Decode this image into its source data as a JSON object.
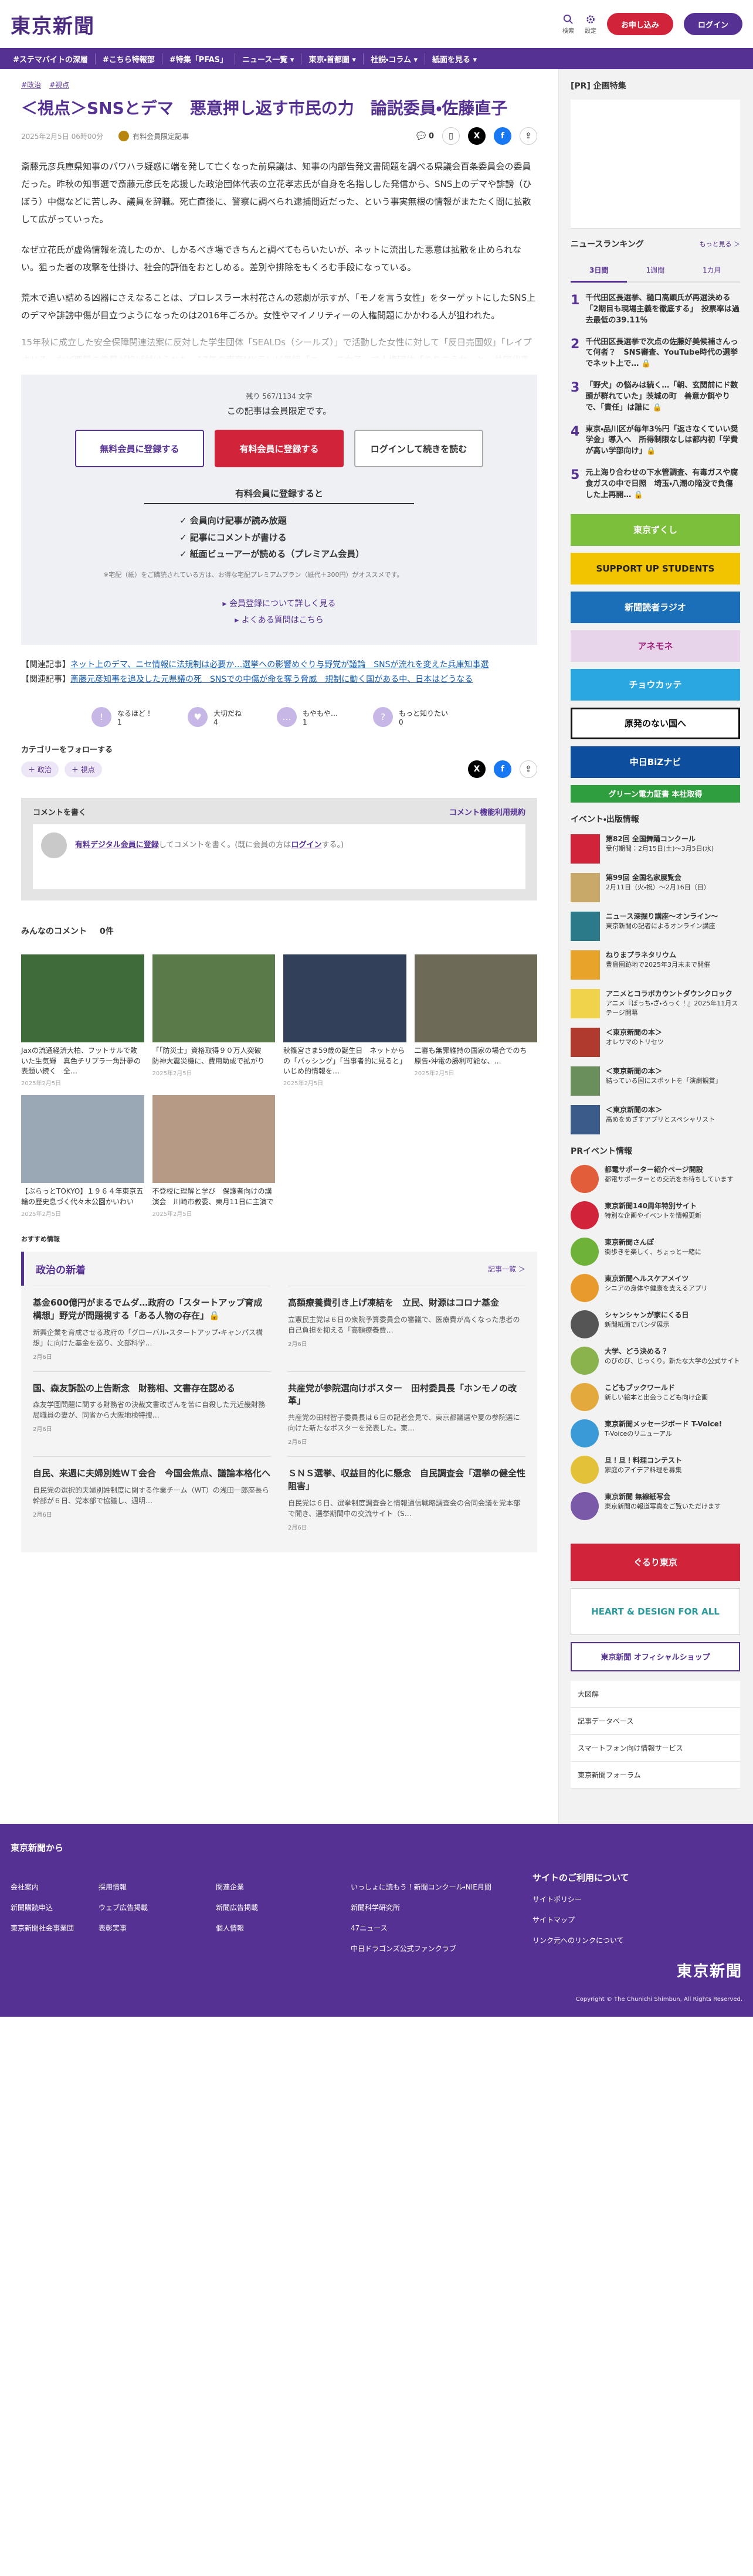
{
  "header": {
    "logo": "東京新聞",
    "search_label": "検索",
    "settings_label": "設定",
    "subscribe_label": "お申し込み",
    "login_label": "ログイン"
  },
  "nav": [
    "#ステマバイトの深層",
    "#こちら特報部",
    "#特集「PFAS」",
    "ニュース一覧 ▾",
    "東京・首都圏 ▾",
    "社説・コラム ▾",
    "紙面を見る ▾"
  ],
  "article": {
    "tags": [
      "#政治",
      "#視点"
    ],
    "title": "＜視点＞SNSとデマ　悪意押し返す市民の力　論説委員・佐藤直子",
    "date": "2025年2月5日 06時00分",
    "badge": "有料会員限定記事",
    "comment_count": "0",
    "paragraphs": [
      "斎藤元彦兵庫県知事のパワハラ疑惑に端を発して亡くなった前県議は、知事の内部告発文書問題を調べる県議会百条委員会の委員だった。昨秋の知事選で斎藤元彦氏を応援した政治団体代表の立花孝志氏が自身を名指しした発信から、SNS上のデマや誹謗（ひぼう）中傷などに苦しみ、議員を辞職。死亡直後に、警察に調べられ逮捕間近だった、という事実無根の情報がまたたく間に拡散して広がっていった。",
      "なぜ立花氏が虚偽情報を流したのか、しかるべき場できちんと調べてもらいたいが、ネットに流出した悪意は拡散を止められない。狙った者の攻撃を仕掛け、社会的評価をおとしめる。差別や排除をもくろむ手段になっている。",
      "荒木で追い詰める凶器にさえなることは、プロレスラー木村花さんの悲劇が示すが、「モノを言う女性」をターゲットにしたSNS上のデマや誹謗中傷が目立つようになったのは2016年ごろか。女性やマイノリティーの人権問題にかかわる人が狙われた。",
      "15年秋に成立した安全保障関連法案に反対した学生団体「SEALDs（シールズ）」で活動した女性に対して「反日売国奴」「レイプさせろ」など悪質の言葉が投げ付けられた。17年の東京MXテレビ番組「ニュース女子」で人権団体「のりこえねっと」共同代表の辛淑玉さんは、沖縄の反基地運動を操る「黒幕」と名指しされ、22年には、性暴力やDV…"
    ]
  },
  "paywall": {
    "count": "残り 567/1134 文字",
    "title": "この記事は会員限定です。",
    "btn_free": "無料会員に登録する",
    "btn_paid": "有料会員に登録する",
    "btn_login": "ログインして続きを読む",
    "benefits_title": "有料会員に登録すると",
    "benefits": [
      "✓ 会員向け記事が読み放題",
      "✓ 記事にコメントが書ける",
      "✓ 紙面ビューアーが読める（プレミアム会員）"
    ],
    "note": "※宅配（紙）をご購読されている方は、お得な宅配プレミアムプラン（紙代＋300円）がオススメです。",
    "link1": "▸ 会員登録について詳しく見る",
    "link2": "▸ よくある質問はこちら"
  },
  "related": [
    {
      "label": "【関連記事】",
      "text": "ネット上のデマ、ニセ情報に法規制は必要か…選挙への影響めぐり与野党が議論　SNSが流れを変えた兵庫知事選"
    },
    {
      "label": "【関連記事】",
      "text": "斎藤元彦知事を追及した元県議の死　SNSでの中傷が命を奪う脅威　規制に動く国がある中、日本はどうなる"
    }
  ],
  "reactions": [
    {
      "label": "なるほど！",
      "count": "1"
    },
    {
      "label": "大切だね",
      "count": "4"
    },
    {
      "label": "もやもや…",
      "count": "1"
    },
    {
      "label": "もっと知りたい",
      "count": "0"
    }
  ],
  "follow": {
    "title": "カテゴリーをフォローする",
    "chips": [
      "＋ 政治",
      "＋ 視点"
    ]
  },
  "comment": {
    "title": "コメントを書く",
    "rules_link": "コメント機能利用規約",
    "login_prefix": "有料デジタル会員に登録",
    "login_mid": "してコメントを書く。(既に会員の方は",
    "login_link": "ログイン",
    "login_suffix": "する。)"
  },
  "all_comments": {
    "title": "みんなのコメント",
    "count": "0件"
  },
  "cards": [
    {
      "cap": "Jaxの流通経済大柏、フットサルで敗いた生気輝　真色チリプラ一角計夢の表題い続く　全…",
      "dt": "2025年2月5日"
    },
    {
      "cap": "「「防災士」資格取得９０万人突破　防神大震災機に、費用助成で拡がり",
      "dt": "2025年2月5日"
    },
    {
      "cap": "秋篠宮さま59歳の誕生日　ネットからの「バッシング」「当事者的に見ると」いじめ的情報を…",
      "dt": "2025年2月5日"
    },
    {
      "cap": "二審も無罪維持の国家の場合でのち　原告・沖電の勝利可能な、…",
      "dt": "2025年2月5日"
    },
    {
      "cap": "【ぶらっとTOKYO】１９６４年東京五輪の歴史息づく代々木公園かいわい",
      "dt": "2025年2月5日"
    },
    {
      "cap": "不登校に理解と学び　保護者向けの講演会　川崎市教委、東月11日に主演で",
      "dt": "2025年2月5日"
    }
  ],
  "osusume": "おすすめ情報",
  "news": {
    "title": "政治の新着",
    "more": "記事一覧 ＞",
    "items": [
      {
        "t": "基金600億円がまるでムダ…政府の「スタートアップ育成構想」野党が問題視する「ある人物の存在」🔒",
        "d": "新興企業を育成させる政府の「グローバル・スタートアップ・キャンパス構想」に向けた基金を巡り、文部科学…",
        "dt": "2月6日"
      },
      {
        "t": "高額療養費引き上げ凍結を　立民、財源はコロナ基金",
        "d": "立憲民主党は６日の衆院予算委員会の審議で、医療費が高くなった患者の自己負担を抑える「高額療養費…",
        "dt": "2月6日"
      },
      {
        "t": "国、森友訴訟の上告断念　財務相、文書存在認める",
        "d": "森友学園問題に関する財務省の決裁文書改ざんを苦に自殺した元近畿財務局職員の妻が、同省から大阪地検特捜…",
        "dt": "2月6日"
      },
      {
        "t": "共産党が参院選向けポスター　田村委員長「ホンモノの改革」",
        "d": "共産党の田村智子委員長は６日の記者会見で、東京都議選や夏の参院選に向けた新たなポスターを発表した。東…",
        "dt": "2月6日"
      },
      {
        "t": "自民、来週に夫婦別姓ＷＴ会合　今国会焦点、議論本格化へ",
        "d": "自民党の選択的夫婦別姓制度に関する作業チーム（WT）の浅田一郎座長ら幹部が６日、党本部で協議し、週明…",
        "dt": "2月6日"
      },
      {
        "t": "ＳＮＳ選挙、収益目的化に懸念　自民調査会「選挙の健全性阻害」",
        "d": "自民党は６日、選挙制度調査会と情報通信戦略調査会の合同会議を党本部で開き、選挙期間中の交流サイト（S…",
        "dt": "2月6日"
      }
    ]
  },
  "sidebar": {
    "pr_title": "[PR] 企画特集",
    "ranking_title": "ニュースランキング",
    "ranking_more": "もっと見る ＞",
    "tabs": [
      "3日間",
      "1週間",
      "1カ月"
    ],
    "ranking": [
      {
        "n": "1",
        "t": "千代田区長選挙、樋口高顕氏が再選決める「2期目も現場主義を徹底する」　投票率は過去最低の39.11％"
      },
      {
        "n": "2",
        "t": "千代田区長選挙で次点の佐藤好美候補さんって何者？　SNS審査、YouTube時代の選挙でネット上で… 🔒"
      },
      {
        "n": "3",
        "t": "「野犬」の悩みは続く…「朝、玄関前にド数頭が群れていた」茨城の町　善意か餌やりで、「責任」は誰に 🔒"
      },
      {
        "n": "4",
        "t": "東京・品川区が毎年3％円「返さなくていい奨学金」導入へ　所得制限なしは都内初「学費が高い学部向け」🔒"
      },
      {
        "n": "5",
        "t": "元上海り合わせの下水管調査、有毒ガスや腐食ガスの中で日照　埼玉・八潮の陥没で負傷した上再開… 🔒"
      }
    ],
    "banners": [
      "東京ずくし",
      "SUPPORT UP STUDENTS",
      "新聞読者ラジオ",
      "アネモネ",
      "チョウカッテ",
      "原発のない国へ",
      "中日BiZナビ",
      "グリーン電力証書 本社取得"
    ],
    "events_title": "イベント・出版情報",
    "events": [
      {
        "b": "第82回 全国舞踊コンクール",
        "d": "受付期間：2月15日(土)〜3月5日(水)"
      },
      {
        "b": "第99回 全国名家展覧会",
        "d": "2月11日（火・祝）〜2月16日（日）"
      },
      {
        "b": "ニュース深掘り講座〜オンライン〜",
        "d": "東京新聞の記者によるオンライン講座"
      },
      {
        "b": "ねりまプラネタリウム",
        "d": "豊島園跡地で2025年3月末まで開催"
      },
      {
        "b": "アニメとコラボカウントダウンクロック",
        "d": "アニメ『ぼっち・ざ・ろっく！』2025年11月ステージ開幕"
      },
      {
        "b": "＜東京新聞の本＞",
        "d": "オレサマのトリセツ"
      },
      {
        "b": "＜東京新聞の本＞",
        "d": "結っている国にスポットを「演劇観賞」"
      },
      {
        "b": "＜東京新聞の本＞",
        "d": "高めをめざすアプリとスペシャリスト"
      }
    ],
    "pr2_title": "PRイベント情報",
    "pr2": [
      {
        "b": "都電サポーター紹介ページ開設",
        "d": "都電サポーターとの交流をお待ちしています"
      },
      {
        "b": "東京新聞140周年特別サイト",
        "d": "特別な企画やイベントを情報更新"
      },
      {
        "b": "東京新聞さんぽ",
        "d": "街歩きを楽しく、ちょっと一緒に"
      },
      {
        "b": "東京新聞ヘルスケアメイツ",
        "d": "シニアの身体や健康を支えるアプリ"
      },
      {
        "b": "シャンシャンが家にくる日",
        "d": "新聞紙面でパンダ展示"
      },
      {
        "b": "大学、どう決める？",
        "d": "のびのび、じっくり。新たな大学の公式サイト"
      },
      {
        "b": "こどもブックワールド",
        "d": "新しい絵本と出会うこども向け企画"
      },
      {
        "b": "東京新聞メッセージボード T-Voice!",
        "d": "T-Voiceのリニューアル"
      },
      {
        "b": "旦！旦！料理コンテスト",
        "d": "家庭のアイデア料理を募集"
      },
      {
        "b": "東京新聞 無線紙写会",
        "d": "東京新聞の報道写真をご覧いただけます"
      }
    ],
    "links": [
      "大図解",
      "記事データベース",
      "スマートフォン向け情報サービス",
      "東京新聞フォーラム"
    ]
  },
  "footer": {
    "brand": "東京新聞から",
    "cols": [
      [
        "会社案内",
        "新聞購読申込",
        "東京新聞社会事業団"
      ],
      [
        "採用情報",
        "ウェブ広告掲載",
        "表彰実事"
      ],
      [
        "関連企業",
        "新聞広告掲載",
        "個人情報"
      ],
      [
        "サイトのご利用について"
      ]
    ],
    "extra": [
      "いっしょに読もう！新聞コンクール・NIE月間",
      "新聞科学研究所",
      "47ニュース",
      "中日ドラゴンズ公式ファンクラブ"
    ],
    "right": [
      "サイトポリシー",
      "サイトマップ",
      "リンク元へのリンクについて"
    ],
    "copyright": "Copyright © The Chunichi Shimbun, All Rights Reserved."
  }
}
